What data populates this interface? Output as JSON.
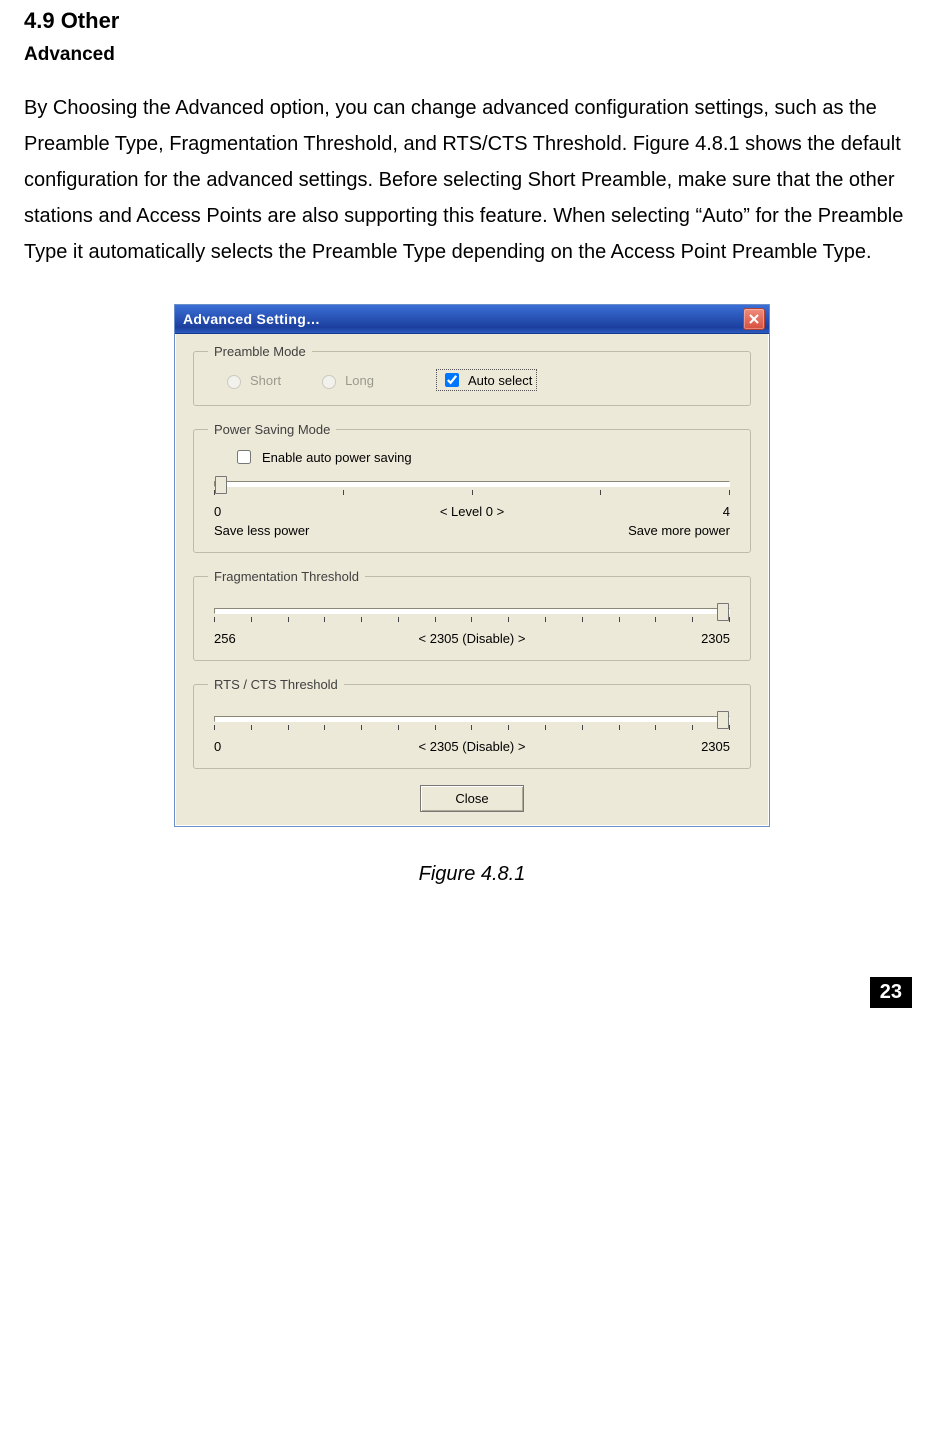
{
  "heading": "4.9  Other",
  "subheading": "Advanced",
  "paragraph": "By Choosing the Advanced option, you can change advanced configuration settings, such as the Preamble Type, Fragmentation Threshold, and RTS/CTS Threshold. Figure 4.8.1 shows the default configuration for the advanced settings. Before selecting Short Preamble, make sure that the other stations and Access Points are also supporting this feature. When selecting “Auto” for the Preamble Type it automatically selects the Preamble Type depending on the Access Point Preamble Type.",
  "dialog": {
    "title": "Advanced Setting…",
    "preamble": {
      "legend": "Preamble Mode",
      "short": "Short",
      "long": "Long",
      "auto": "Auto select"
    },
    "power": {
      "legend": "Power Saving Mode",
      "checkbox": "Enable auto power saving",
      "min": "0",
      "max": "4",
      "level": "< Level 0 >",
      "left_label": "Save less power",
      "right_label": "Save more power"
    },
    "frag": {
      "legend": "Fragmentation Threshold",
      "min": "256",
      "max": "2305",
      "value": "< 2305 (Disable) >"
    },
    "rts": {
      "legend": "RTS / CTS Threshold",
      "min": "0",
      "max": "2305",
      "value": "< 2305 (Disable) >"
    },
    "close_btn": "Close"
  },
  "figure_caption": "Figure 4.8.1",
  "page_number": "23"
}
